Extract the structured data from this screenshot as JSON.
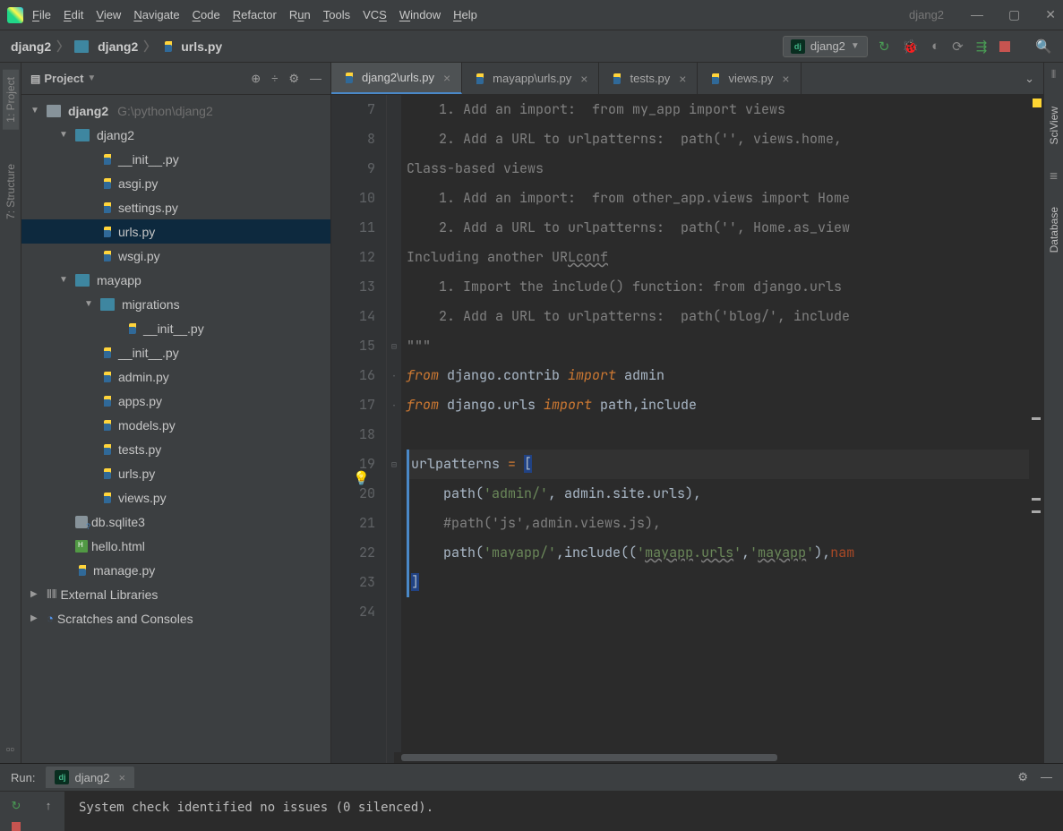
{
  "window": {
    "title": "djang2"
  },
  "menu": {
    "file": "File",
    "edit": "Edit",
    "view": "View",
    "navigate": "Navigate",
    "code": "Code",
    "refactor": "Refactor",
    "run": "Run",
    "tools": "Tools",
    "vcs": "VCS",
    "window": "Window",
    "help": "Help"
  },
  "breadcrumbs": [
    "djang2",
    "djang2",
    "urls.py"
  ],
  "run_config": {
    "name": "djang2"
  },
  "sidebar": {
    "title": "Project",
    "root": {
      "name": "djang2",
      "path": "G:\\python\\djang2"
    },
    "items": [
      {
        "name": "djang2",
        "depth": 1,
        "type": "pkg",
        "exp": true
      },
      {
        "name": "__init__.py",
        "depth": 2,
        "type": "py"
      },
      {
        "name": "asgi.py",
        "depth": 2,
        "type": "py"
      },
      {
        "name": "settings.py",
        "depth": 2,
        "type": "py"
      },
      {
        "name": "urls.py",
        "depth": 2,
        "type": "py",
        "sel": true
      },
      {
        "name": "wsgi.py",
        "depth": 2,
        "type": "py"
      },
      {
        "name": "mayapp",
        "depth": 1,
        "type": "pkg",
        "exp": true
      },
      {
        "name": "migrations",
        "depth": 2,
        "type": "pkg",
        "exp": true
      },
      {
        "name": "__init__.py",
        "depth": 3,
        "type": "py"
      },
      {
        "name": "__init__.py",
        "depth": 2,
        "type": "py"
      },
      {
        "name": "admin.py",
        "depth": 2,
        "type": "py"
      },
      {
        "name": "apps.py",
        "depth": 2,
        "type": "py"
      },
      {
        "name": "models.py",
        "depth": 2,
        "type": "py"
      },
      {
        "name": "tests.py",
        "depth": 2,
        "type": "py"
      },
      {
        "name": "urls.py",
        "depth": 2,
        "type": "py"
      },
      {
        "name": "views.py",
        "depth": 2,
        "type": "py"
      },
      {
        "name": "db.sqlite3",
        "depth": 1,
        "type": "db"
      },
      {
        "name": "hello.html",
        "depth": 1,
        "type": "html"
      },
      {
        "name": "manage.py",
        "depth": 1,
        "type": "py"
      }
    ],
    "ext_lib": "External Libraries",
    "scratches": "Scratches and Consoles"
  },
  "left_tools": {
    "project": "1: Project",
    "structure": "7: Structure"
  },
  "right_tools": {
    "sciview": "SciView",
    "database": "Database"
  },
  "tabs": [
    {
      "label": "djang2\\urls.py",
      "active": true
    },
    {
      "label": "mayapp\\urls.py"
    },
    {
      "label": "tests.py"
    },
    {
      "label": "views.py"
    }
  ],
  "code": {
    "start": 7,
    "lines": [
      "    1. Add an import:  from my_app import views",
      "    2. Add a URL to urlpatterns:  path('', views.home,",
      "Class-based views",
      "    1. Add an import:  from other_app.views import Home",
      "    2. Add a URL to urlpatterns:  path('', Home.as_view",
      "Including another URLconf",
      "    1. Import the include() function: from django.urls",
      "    2. Add a URL to urlpatterns:  path('blog/', include",
      "\"\"\"",
      "from django.contrib import admin",
      "from django.urls import path,include",
      "",
      "urlpatterns = [",
      "    path('admin/', admin.site.urls),",
      "    #path('js',admin.views.js),",
      "    path('mayapp/',include(('mayapp.urls','mayapp'),nam",
      "]",
      ""
    ]
  },
  "run_panel": {
    "title": "Run:",
    "tab": "djang2",
    "output": "System check identified no issues (0 silenced)."
  }
}
